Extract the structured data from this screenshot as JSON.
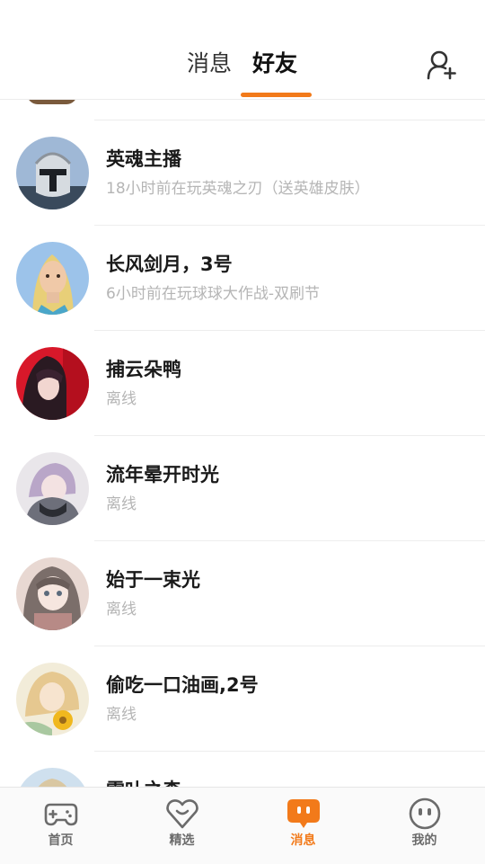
{
  "header": {
    "tab_messages": "消息",
    "tab_friends": "好友",
    "active_tab": "好友",
    "accent_color": "#f27a1a",
    "add_friend_icon": "add-user-icon"
  },
  "friends": [
    {
      "name": "英魂主播",
      "status": "18小时前在玩英魂之刃（送英雄皮肤）"
    },
    {
      "name": "长风剑月，3号",
      "status": "6小时前在玩球球大作战-双刷节"
    },
    {
      "name": "捕云朵鸭",
      "status": "离线"
    },
    {
      "name": "流年晕开时光",
      "status": "离线"
    },
    {
      "name": "始于一束光",
      "status": "离线"
    },
    {
      "name": "偷吃一口油画,2号",
      "status": "离线"
    },
    {
      "name": "雪叶之森",
      "status": ""
    }
  ],
  "bottom_nav": [
    {
      "label": "首页",
      "icon": "gamepad-icon"
    },
    {
      "label": "精选",
      "icon": "heart-icon"
    },
    {
      "label": "消息",
      "icon": "chat-bubble-icon",
      "active": true
    },
    {
      "label": "我的",
      "icon": "face-icon"
    }
  ]
}
